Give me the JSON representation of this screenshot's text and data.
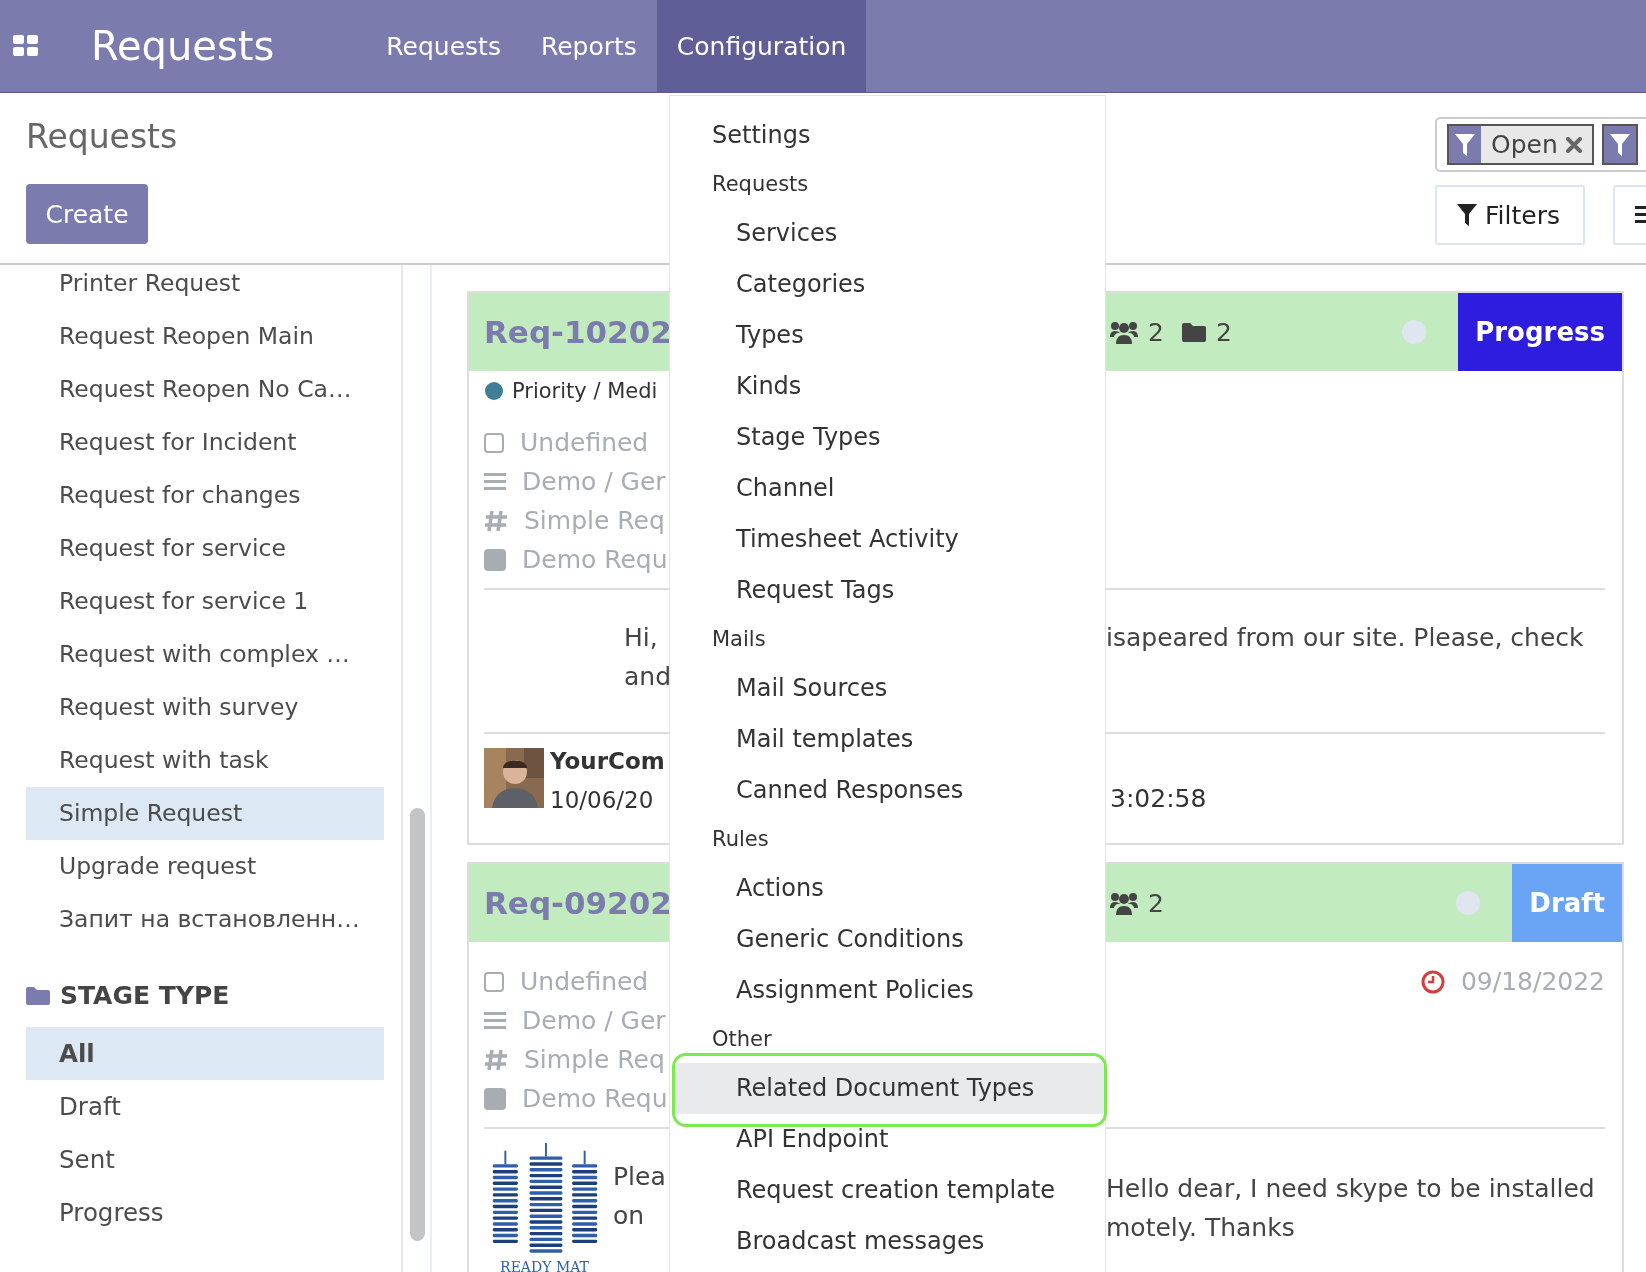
{
  "navbar": {
    "app_title": "Requests",
    "menu": [
      {
        "label": "Requests",
        "selected": false
      },
      {
        "label": "Reports",
        "selected": false
      },
      {
        "label": "Configuration",
        "selected": true
      }
    ]
  },
  "control_panel": {
    "breadcrumb": "Requests",
    "create_button": "Create",
    "facets": [
      {
        "kind": "full",
        "label": "Open"
      },
      {
        "kind": "cut"
      }
    ],
    "filters_button": "Filters"
  },
  "sidebar": {
    "groups": [
      {
        "items": [
          {
            "label": "Printer Request",
            "selected": false
          },
          {
            "label": "Request Reopen Main",
            "selected": false
          },
          {
            "label": "Request Reopen No Ca…",
            "selected": false
          },
          {
            "label": "Request for Incident",
            "selected": false
          },
          {
            "label": "Request for changes",
            "selected": false
          },
          {
            "label": "Request for service",
            "selected": false
          },
          {
            "label": "Request for service 1",
            "selected": false
          },
          {
            "label": "Request with complex …",
            "selected": false
          },
          {
            "label": "Request with survey",
            "selected": false
          },
          {
            "label": "Request with task",
            "selected": false
          },
          {
            "label": "Simple Request",
            "selected": true
          },
          {
            "label": "Upgrade request",
            "selected": false
          },
          {
            "label": "Запит на встановленн…",
            "selected": false
          }
        ]
      },
      {
        "header": "STAGE TYPE",
        "items": [
          {
            "label": "All",
            "selected": true
          },
          {
            "label": "Draft",
            "selected": false
          },
          {
            "label": "Sent",
            "selected": false
          },
          {
            "label": "Progress",
            "selected": false
          }
        ]
      }
    ]
  },
  "cards": [
    {
      "title": "Req-10202",
      "stage": "Progress",
      "color": "#2f1ddf",
      "counters": [
        {
          "kind": "people",
          "count": "2"
        },
        {
          "kind": "folder",
          "count": "2"
        }
      ],
      "priority": "Priority / Medi",
      "fields": [
        {
          "kind": "checkbox",
          "text": "Undefined"
        },
        {
          "kind": "lines",
          "text": "Demo / Ger"
        },
        {
          "kind": "hash",
          "text": "Simple Req"
        },
        {
          "kind": "square",
          "text": "Demo Requ"
        }
      ],
      "message": {
        "kind": "text",
        "left": [
          "Hi,",
          "and"
        ],
        "right": [
          "isapeared from our site. Please, check"
        ]
      },
      "footer": {
        "author": "YourCom",
        "date": "10/06/20",
        "time": "3:02:58"
      }
    },
    {
      "title": "Req-09202",
      "stage": "Draft",
      "color": "#6aa4f5",
      "counters": [
        {
          "kind": "people",
          "count": "2"
        }
      ],
      "deadline": "09/18/2022",
      "fields": [
        {
          "kind": "checkbox",
          "text": "Undefined"
        },
        {
          "kind": "lines",
          "text": "Demo / Ger"
        },
        {
          "kind": "hash",
          "text": "Simple Req"
        },
        {
          "kind": "square",
          "text": "Demo Requ"
        }
      ],
      "message": {
        "kind": "logo",
        "logo_text": "READY MAT",
        "left": [
          "Plea",
          "on"
        ],
        "right": [
          "Hello dear, I need skype to be installed",
          "motely. Thanks"
        ]
      }
    }
  ],
  "dropdown": {
    "items": [
      {
        "kind": "item",
        "label": "Settings",
        "selected": false,
        "outlined": false
      },
      {
        "kind": "header",
        "label": "Requests"
      },
      {
        "kind": "subitem",
        "label": "Services",
        "selected": false,
        "outlined": false
      },
      {
        "kind": "subitem",
        "label": "Categories",
        "selected": false,
        "outlined": false
      },
      {
        "kind": "subitem",
        "label": "Types",
        "selected": false,
        "outlined": false
      },
      {
        "kind": "subitem",
        "label": "Kinds",
        "selected": false,
        "outlined": false
      },
      {
        "kind": "subitem",
        "label": "Stage Types",
        "selected": false,
        "outlined": false
      },
      {
        "kind": "subitem",
        "label": "Channel",
        "selected": false,
        "outlined": false
      },
      {
        "kind": "subitem",
        "label": "Timesheet Activity",
        "selected": false,
        "outlined": false
      },
      {
        "kind": "subitem",
        "label": "Request Tags",
        "selected": false,
        "outlined": false
      },
      {
        "kind": "header",
        "label": "Mails"
      },
      {
        "kind": "subitem",
        "label": "Mail Sources",
        "selected": false,
        "outlined": false
      },
      {
        "kind": "subitem",
        "label": "Mail templates",
        "selected": false,
        "outlined": false
      },
      {
        "kind": "subitem",
        "label": "Canned Responses",
        "selected": false,
        "outlined": false
      },
      {
        "kind": "header",
        "label": "Rules"
      },
      {
        "kind": "subitem",
        "label": "Actions",
        "selected": false,
        "outlined": false
      },
      {
        "kind": "subitem",
        "label": "Generic Conditions",
        "selected": false,
        "outlined": false
      },
      {
        "kind": "subitem",
        "label": "Assignment Policies",
        "selected": false,
        "outlined": false
      },
      {
        "kind": "header",
        "label": "Other"
      },
      {
        "kind": "subitem",
        "label": "Related Document Types",
        "selected": true,
        "outlined": true
      },
      {
        "kind": "subitem",
        "label": "API Endpoint",
        "selected": false,
        "outlined": false
      },
      {
        "kind": "subitem",
        "label": "Request creation template",
        "selected": false,
        "outlined": false
      },
      {
        "kind": "subitem",
        "label": "Broadcast messages",
        "selected": false,
        "outlined": false
      }
    ]
  }
}
